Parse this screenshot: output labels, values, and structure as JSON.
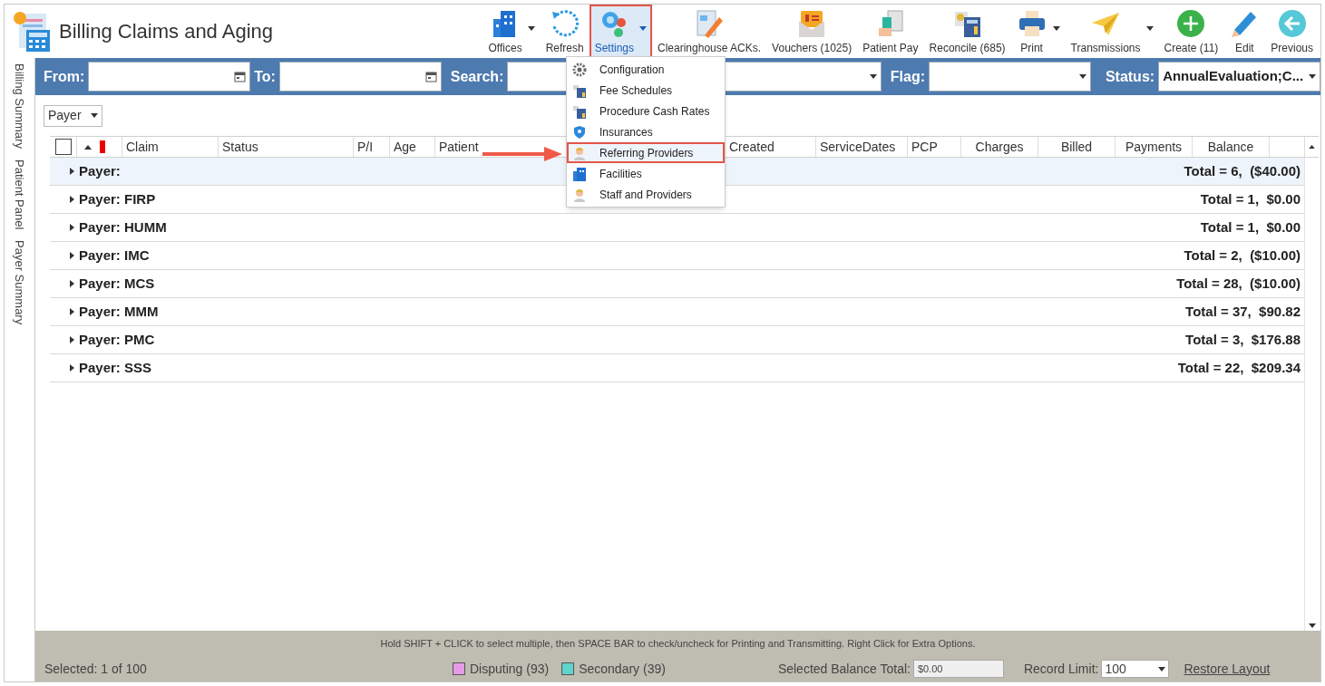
{
  "title": "Billing Claims and Aging",
  "toolbar": [
    {
      "label": "Offices",
      "has_menu": true,
      "highlighted": false
    },
    {
      "label": "Refresh",
      "has_menu": false,
      "highlighted": false
    },
    {
      "label": "Settings",
      "has_menu": true,
      "highlighted": true
    },
    {
      "label": "Clearinghouse ACKs.",
      "has_menu": false,
      "highlighted": false
    },
    {
      "label": "Vouchers (1025)",
      "has_menu": false,
      "highlighted": false
    },
    {
      "label": "Patient Pay",
      "has_menu": false,
      "highlighted": false
    },
    {
      "label": "Reconcile (685)",
      "has_menu": false,
      "highlighted": false
    },
    {
      "label": "Print",
      "has_menu": true,
      "highlighted": false
    },
    {
      "label": "Transmissions",
      "has_menu": true,
      "highlighted": false
    },
    {
      "label": "Create (11)",
      "has_menu": false,
      "highlighted": false
    },
    {
      "label": "Edit",
      "has_menu": false,
      "highlighted": false
    },
    {
      "label": "Previous",
      "has_menu": false,
      "highlighted": false
    }
  ],
  "filters": {
    "from": {
      "label": "From:"
    },
    "to": {
      "label": "To:"
    },
    "search": {
      "label": "Search:"
    },
    "flag": {
      "label": "Flag:"
    },
    "status": {
      "label": "Status:",
      "value": "AnnualEvaluation;C..."
    }
  },
  "side_tabs": [
    "Billing Summary",
    "Patient Panel",
    "Payer Summary"
  ],
  "group_by": "Payer",
  "table": {
    "select_all": {
      "checked": false
    },
    "columns": [
      "Claim",
      "Status",
      "P/I",
      "Age",
      "Patient",
      "Created",
      "ServiceDates",
      "PCP",
      "Charges",
      "Billed",
      "Payments",
      "Balance"
    ],
    "rows": [
      {
        "label": "Payer:",
        "total": "Total = 6,  ($40.00)",
        "selected": true
      },
      {
        "label": "Payer: FIRP",
        "total": "Total = 1,  $0.00",
        "selected": false
      },
      {
        "label": "Payer: HUMM",
        "total": "Total = 1,  $0.00",
        "selected": false
      },
      {
        "label": "Payer: IMC",
        "total": "Total = 2,  ($10.00)",
        "selected": false
      },
      {
        "label": "Payer: MCS",
        "total": "Total = 28,  ($10.00)",
        "selected": false
      },
      {
        "label": "Payer: MMM",
        "total": "Total = 37,  $90.82",
        "selected": false
      },
      {
        "label": "Payer: PMC",
        "total": "Total = 3,  $176.88",
        "selected": false
      },
      {
        "label": "Payer: SSS",
        "total": "Total = 22,  $209.34",
        "selected": false
      }
    ]
  },
  "settings_menu": [
    {
      "label": "Configuration",
      "highlighted": false
    },
    {
      "label": "Fee Schedules",
      "highlighted": false
    },
    {
      "label": "Procedure Cash Rates",
      "highlighted": false
    },
    {
      "label": "Insurances",
      "highlighted": false
    },
    {
      "label": "Referring Providers",
      "highlighted": true
    },
    {
      "label": "Facilities",
      "highlighted": false
    },
    {
      "label": "Staff and Providers",
      "highlighted": false
    }
  ],
  "footer": {
    "hint": "Hold SHIFT + CLICK to select multiple, then SPACE BAR to check/uncheck for Printing and Transmitting. Right Click for Extra Options.",
    "selected": "Selected: 1 of 100",
    "legend": [
      {
        "label": "Disputing (93)",
        "color": "#e59ce8"
      },
      {
        "label": "Secondary (39)",
        "color": "#5fd3cc"
      }
    ],
    "balance_label": "Selected Balance Total:",
    "balance_value": "$0.00",
    "record_limit_label": "Record Limit:",
    "record_limit_value": "100",
    "restore": "Restore Layout"
  }
}
